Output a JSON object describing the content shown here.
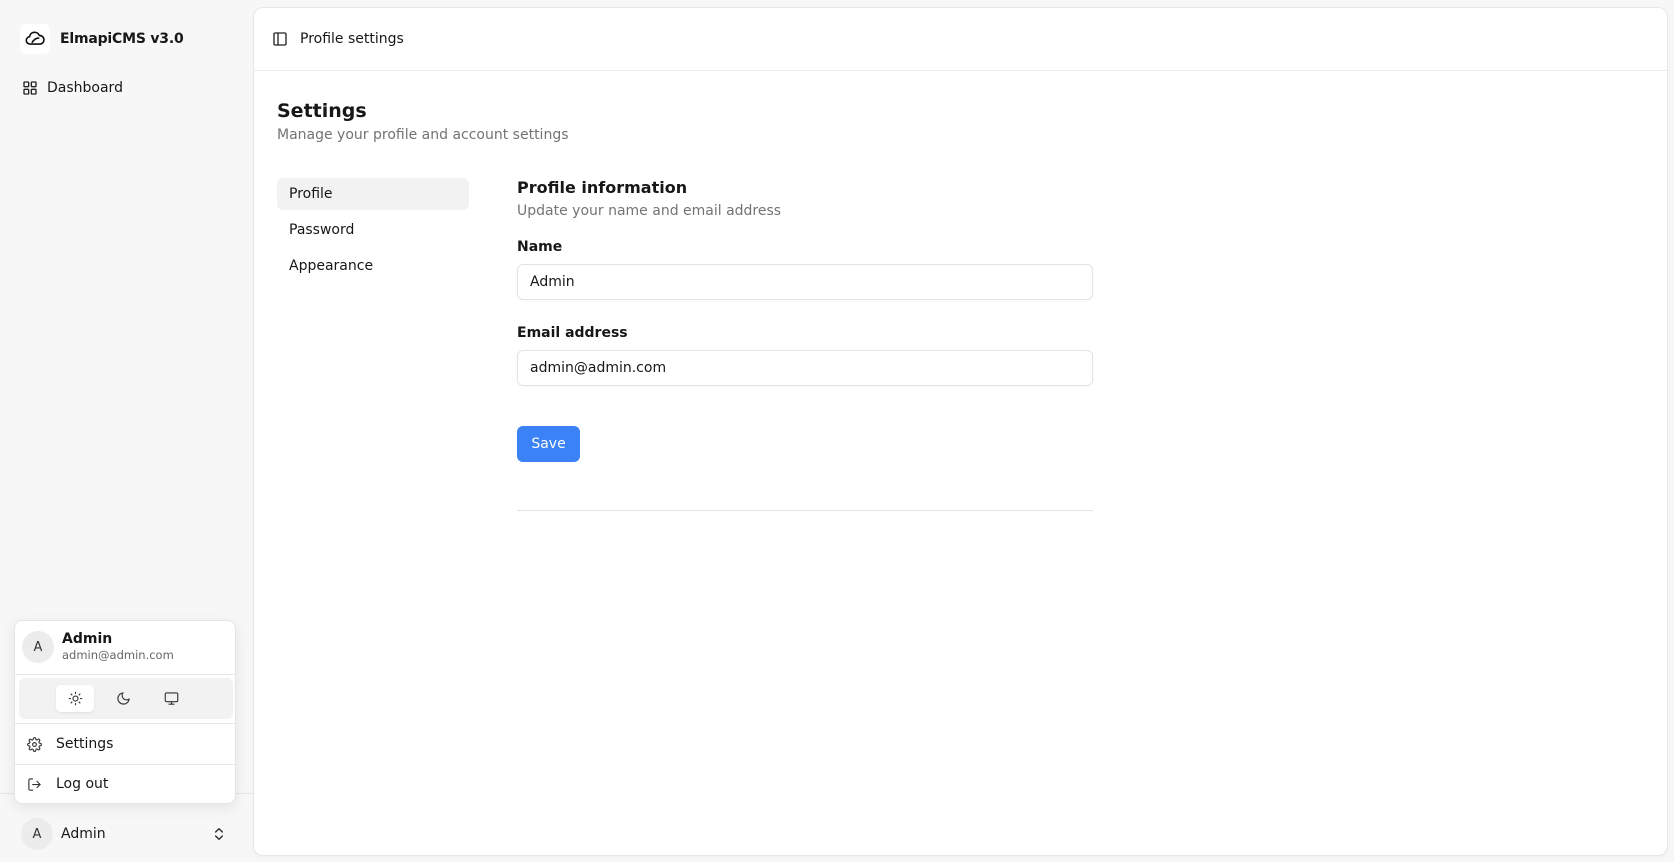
{
  "app": {
    "name": "ElmapiCMS v3.0"
  },
  "sidebar": {
    "nav": [
      {
        "label": "Dashboard",
        "icon": "layout-grid-icon"
      }
    ],
    "user": {
      "initial": "A",
      "name": "Admin",
      "email": "admin@admin.com"
    }
  },
  "user_menu": {
    "theme_options": [
      {
        "icon": "sun-icon",
        "state": "selected"
      },
      {
        "icon": "moon-icon"
      },
      {
        "icon": "monitor-icon"
      }
    ],
    "items": [
      {
        "label": "Settings",
        "icon": "gear-icon"
      },
      {
        "label": "Log out",
        "icon": "log-out-icon"
      }
    ]
  },
  "topbar": {
    "title": "Profile settings",
    "toggle_icon": "sidebar-toggle-icon"
  },
  "page": {
    "title": "Settings",
    "subtitle": "Manage your profile and account settings",
    "tabs": [
      {
        "label": "Profile",
        "active": true
      },
      {
        "label": "Password"
      },
      {
        "label": "Appearance"
      }
    ]
  },
  "profile_form": {
    "title": "Profile information",
    "subtitle": "Update your name and email address",
    "name_label": "Name",
    "name_value": "Admin",
    "email_label": "Email address",
    "email_value": "admin@admin.com",
    "save_label": "Save"
  },
  "colors": {
    "accent": "#3b82f6",
    "sidebar_bg": "#f7f7f7",
    "surface": "#ffffff"
  }
}
